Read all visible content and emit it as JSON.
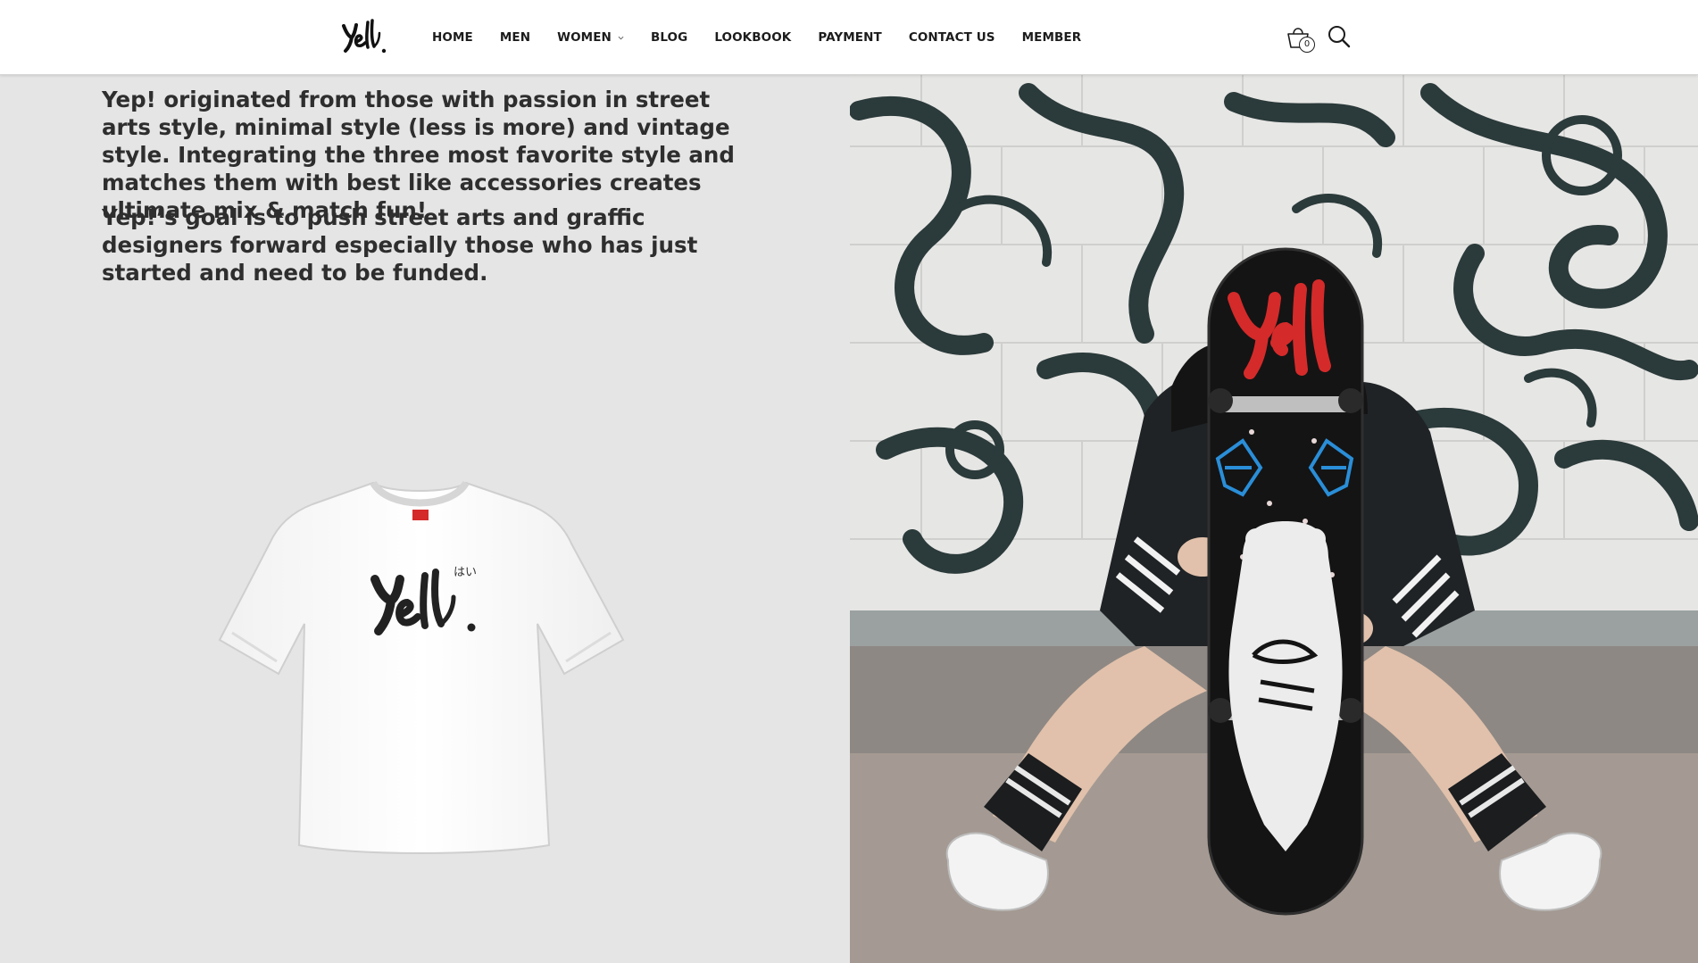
{
  "brand": {
    "logo_text": "Yep!",
    "logo_icon": "yep-logo-icon"
  },
  "nav": {
    "items": [
      {
        "label": "HOME"
      },
      {
        "label": "MEN"
      },
      {
        "label": "WOMEN",
        "has_dropdown": true
      },
      {
        "label": "BLOG"
      },
      {
        "label": "LOOKBOOK"
      },
      {
        "label": "PAYMENT"
      },
      {
        "label": "CONTACT US"
      },
      {
        "label": "MEMBER"
      }
    ]
  },
  "cart": {
    "icon": "shopping-bag-icon",
    "count": "0"
  },
  "search": {
    "icon": "search-icon"
  },
  "content": {
    "paragraph_1": "Yep! originated from those with passion in street arts style, minimal style (less is more) and vintage style. Integrating the three most favorite style and matches them with best like accessories creates ultimate mix & match fun!",
    "paragraph_2": "Yep!’s goal is to push street arts and graffic designers forward especially those who has just started and need to be funded."
  },
  "product_image": {
    "icon": "tshirt-image",
    "print_text": "Yep!",
    "print_subtext": "はい"
  },
  "lifestyle_image": {
    "icon": "skateboard-photo"
  },
  "colors": {
    "header_bg": "#ffffff",
    "page_bg": "#e5e5e5",
    "text": "#2e2e2e",
    "accent_red": "#d52a2a",
    "accent_blue": "#2a8ed8"
  }
}
